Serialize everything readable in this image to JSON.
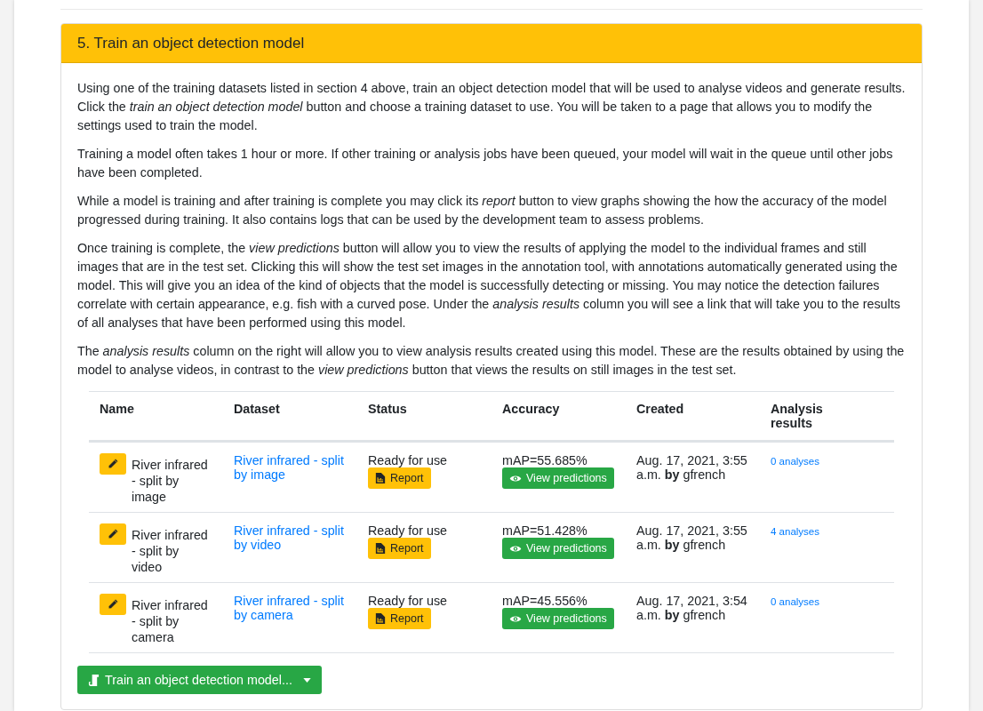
{
  "section": {
    "title": "5. Train an object detection model",
    "paragraphs": [
      "Using one of the training datasets listed in section 4 above, train an object detection model that will be used to analyse videos and generate results. Click the *train an object detection model* button and choose a training dataset to use. You will be taken to a page that allows you to modify the settings used to train the model.",
      "Training a model often takes 1 hour or more. If other training or analysis jobs have been queued, your model will wait in the queue until other jobs have been completed.",
      "While a model is training and after training is complete you may click its *report* button to view graphs showing the how the accuracy of the model progressed during training. It also contains logs that can be used by the development team to assess problems.",
      "Once training is complete, the *view predictions* button will allow you to view the results of applying the model to the individual frames and still images that are in the test set. Clicking this will show the test set images in the annotation tool, with annotations automatically generated using the model. This will give you an idea of the kind of objects that the model is successfully detecting or missing. You may notice the detection failures correlate with certain appearance, e.g. fish with a curved pose. Under the *analysis results* column you will see a link that will take you to the results of all analyses that have been performed using this model.",
      "The *analysis results* column on the right will allow you to view analysis results created using this model. These are the results obtained by using the model to analyse videos, in contrast to the *view predictions* button that views the results on still images in the test set."
    ],
    "table": {
      "columns": [
        "Name",
        "Dataset",
        "Status",
        "Accuracy",
        "Created",
        "Analysis results"
      ],
      "rows": [
        {
          "name": "River infrared - split by image",
          "dataset": "River infrared - split by image",
          "status": "Ready for use",
          "report_button": "Report",
          "accuracy": "mAP=55.685%",
          "predictions_button": "View predictions",
          "created": "Aug. 17, 2021, 3:55 a.m. **by** gfrench",
          "analyses": "0 analyses"
        },
        {
          "name": "River infrared - split by video",
          "dataset": "River infrared - split by video",
          "status": "Ready for use",
          "report_button": "Report",
          "accuracy": "mAP=51.428%",
          "predictions_button": "View predictions",
          "created": "Aug. 17, 2021, 3:55 a.m. **by** gfrench",
          "analyses": "4 analyses"
        },
        {
          "name": "River infrared - split by camera",
          "dataset": "River infrared - split by camera",
          "status": "Ready for use",
          "report_button": "Report",
          "accuracy": "mAP=45.556%",
          "predictions_button": "View predictions",
          "created": "Aug. 17, 2021, 3:54 a.m. **by** gfrench",
          "analyses": "0 analyses"
        }
      ]
    },
    "train_button": "Train an object detection model..."
  }
}
